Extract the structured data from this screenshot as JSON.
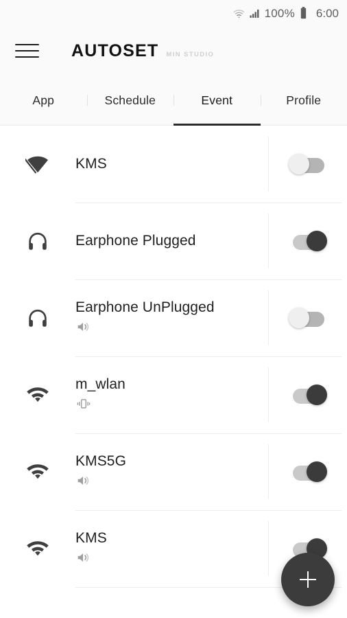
{
  "status_bar": {
    "wifi_icon": "wifi-icon",
    "signal_icon": "cellular-signal-icon",
    "battery_percent": "100%",
    "battery_icon": "battery-full-icon",
    "time": "6:00"
  },
  "app_bar": {
    "menu_icon": "hamburger-menu-icon",
    "title": "AUTOSET",
    "subtitle": "MIN STUDIO"
  },
  "tabs": [
    {
      "label": "App",
      "active": false
    },
    {
      "label": "Schedule",
      "active": false
    },
    {
      "label": "Event",
      "active": true
    },
    {
      "label": "Profile",
      "active": false
    }
  ],
  "events": [
    {
      "icon": "wifi-off-icon",
      "title": "KMS",
      "action_icon": "",
      "toggle_state": "off"
    },
    {
      "icon": "headphones-icon",
      "title": "Earphone Plugged",
      "action_icon": "",
      "toggle_state": "on"
    },
    {
      "icon": "headphones-icon",
      "title": "Earphone UnPlugged",
      "action_icon": "volume-up-icon",
      "toggle_state": "off"
    },
    {
      "icon": "wifi-icon",
      "title": "m_wlan",
      "action_icon": "vibrate-icon",
      "toggle_state": "on"
    },
    {
      "icon": "wifi-icon",
      "title": "KMS5G",
      "action_icon": "volume-up-icon",
      "toggle_state": "on"
    },
    {
      "icon": "wifi-icon",
      "title": "KMS",
      "action_icon": "volume-up-icon",
      "toggle_state": "on"
    }
  ],
  "fab": {
    "icon": "plus-icon",
    "label": "+"
  },
  "colors": {
    "accent_dark": "#3d3c3c",
    "app_bar_bg": "#fafafa",
    "content_bg": "#ffffff",
    "toggle_on_thumb": "#3b3b3b",
    "toggle_off_thumb": "#efefef",
    "divider": "#ededed",
    "subtitle_gray": "#cfcfcf"
  }
}
